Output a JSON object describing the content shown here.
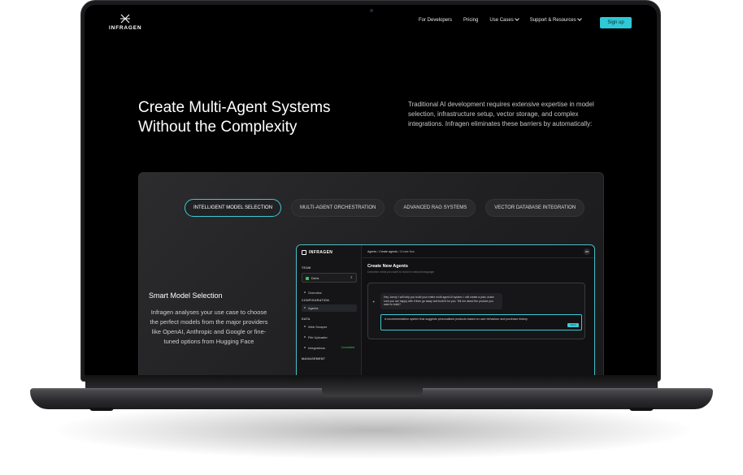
{
  "nav": {
    "brand": "INFRAGEN",
    "links": [
      {
        "label": "For Developers",
        "has_dropdown": false
      },
      {
        "label": "Pricing",
        "has_dropdown": false
      },
      {
        "label": "Use Cases",
        "has_dropdown": true
      },
      {
        "label": "Support & Resources",
        "has_dropdown": true
      }
    ],
    "signup_label": "Sign up",
    "accent_color": "#2ec8d6"
  },
  "hero": {
    "title_line1": "Create Multi-Agent Systems",
    "title_line2": "Without the Complexity",
    "description": "Traditional AI development requires extensive expertise in model selection, infrastructure setup, vector storage, and complex integrations. Infragen eliminates these barriers by automatically:"
  },
  "showcase": {
    "tabs": [
      {
        "label": "INTELLIGENT MODEL SELECTION",
        "active": true
      },
      {
        "label": "MULTI-AGENT ORCHESTRATION",
        "active": false
      },
      {
        "label": "ADVANCED RAG SYSTEMS",
        "active": false
      },
      {
        "label": "VECTOR DATABASE INTEGRATION",
        "active": false
      }
    ],
    "feature_title": "Smart Model Selection",
    "feature_desc": "Infragen analyses your use case to choose the perfect models from the major providers like OpenAI, Anthropic and Google or fine-tuned options from Hugging Face"
  },
  "app": {
    "brand": "INFRAGEN",
    "team_heading": "TEAM",
    "team_name": "Deris",
    "configuration_heading": "CONFIGURATION",
    "config_items": [
      "Overview",
      "Agents"
    ],
    "data_heading": "DATA",
    "data_items": [
      "Web Scraper",
      "File Uploader",
      "Integrations"
    ],
    "integrations_status": "Connected",
    "management_heading": "MANAGEMENT",
    "breadcrumb_parent": "Agents",
    "breadcrumb_mid": "Create agents",
    "breadcrumb_current": "Create flow",
    "avatar_initials": "MB",
    "page_title": "Create New Agents",
    "page_subtitle": "Describe what you want to build in natural language",
    "bot_message": "Hey Jonny! I will help you build your entire multi agent AI system. I will create a plan, make sure you are happy with it then go away and build it for you. Tell me about the product you want to build?",
    "input_value": "A recommendation system that suggests personalised products based on user behaviour and purchase history",
    "send_label": "Send"
  }
}
